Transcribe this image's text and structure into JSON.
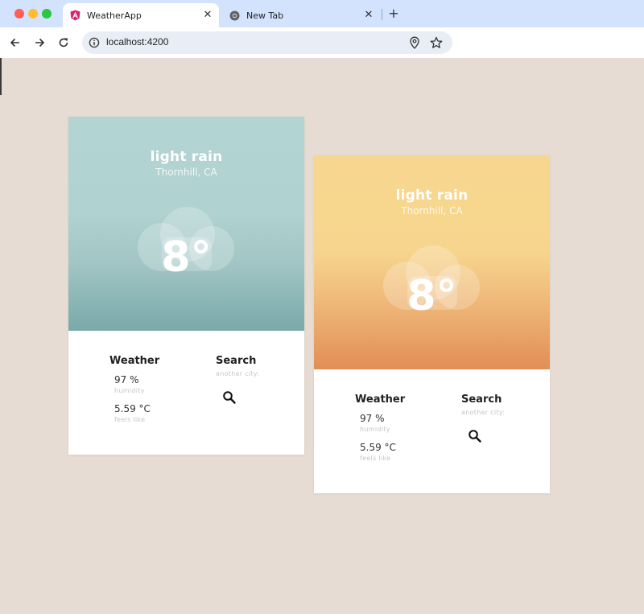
{
  "browser": {
    "tabs": [
      {
        "title": "WeatherApp",
        "icon": "angular-icon",
        "active": true
      },
      {
        "title": "New Tab",
        "icon": "chrome-icon",
        "active": false
      }
    ],
    "url": "localhost:4200"
  },
  "cards": [
    {
      "condition": "light rain",
      "location": "Thornhill, CA",
      "temperature": "8°",
      "weather_heading": "Weather",
      "humidity_value": "97 %",
      "humidity_label": "humidity",
      "feels_like_value": "5.59 °C",
      "feels_like_label": "feels like",
      "search_heading": "Search",
      "search_hint": "another city:",
      "theme": {
        "top": "#b3d4d3",
        "bottom": "#7aa9aa"
      }
    },
    {
      "condition": "light rain",
      "location": "Thornhill, CA",
      "temperature": "8°",
      "weather_heading": "Weather",
      "humidity_value": "97 %",
      "humidity_label": "humidity",
      "feels_like_value": "5.59 °C",
      "feels_like_label": "feels like",
      "search_heading": "Search",
      "search_hint": "another city:",
      "theme": {
        "top": "#f7d78f",
        "bottom": "#e28e56"
      }
    }
  ],
  "colors": {
    "page_background": "#e6dcd3",
    "tab_strip": "#d3e3fd"
  }
}
